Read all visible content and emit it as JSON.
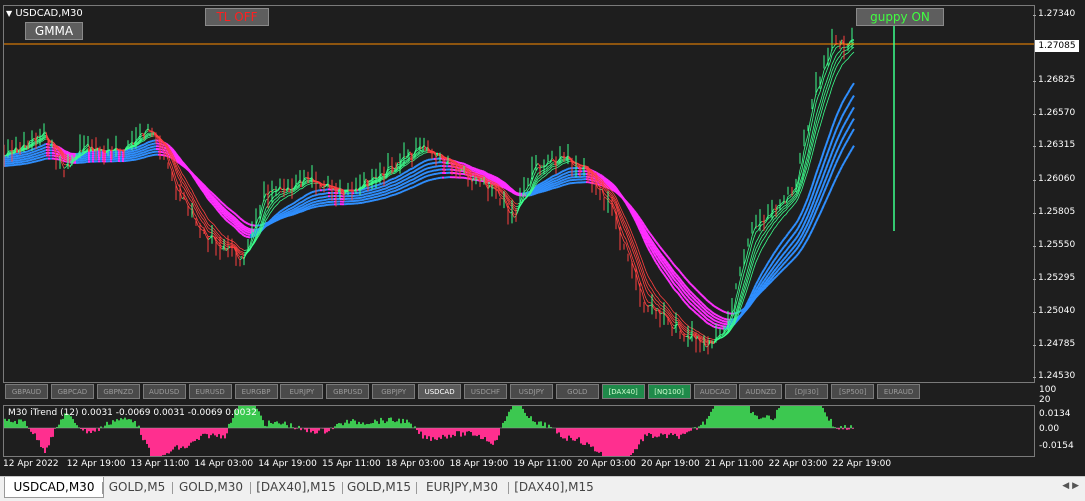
{
  "window_title": "USDCAD,M30",
  "buttons": {
    "gmma": "GMMA",
    "tl": "TL OFF",
    "guppy": "guppy ON"
  },
  "colors": {
    "background": "#1e1e1e",
    "gmma_short_up": "#3cff8c",
    "gmma_short_down": "#ff4040",
    "gmma_long_up": "#2f8fff",
    "gmma_long_down": "#ff2fff",
    "price_line": "#ff8c00",
    "subwindow_positive": "#ff2f8f",
    "subwindow_negative": "#3cc850"
  },
  "price_axis": [
    "1.27340",
    "1.26825",
    "1.26570",
    "1.26315",
    "1.26060",
    "1.25805",
    "1.25550",
    "1.25295",
    "1.25040",
    "1.24785",
    "1.24530"
  ],
  "current_price": "1.27085",
  "symbols": [
    {
      "label": "GBPAUD",
      "state": "normal"
    },
    {
      "label": "GBPCAD",
      "state": "normal"
    },
    {
      "label": "GBPNZD",
      "state": "normal"
    },
    {
      "label": "AUDUSD",
      "state": "normal"
    },
    {
      "label": "EURUSD",
      "state": "normal"
    },
    {
      "label": "EURGBP",
      "state": "normal"
    },
    {
      "label": "EURJPY",
      "state": "normal"
    },
    {
      "label": "GBPUSD",
      "state": "normal"
    },
    {
      "label": "GBPJPY",
      "state": "normal"
    },
    {
      "label": "USDCAD",
      "state": "active"
    },
    {
      "label": "USDCHF",
      "state": "normal"
    },
    {
      "label": "USDJPY",
      "state": "normal"
    },
    {
      "label": "GOLD",
      "state": "normal"
    },
    {
      "label": "[DAX40]",
      "state": "green"
    },
    {
      "label": "[NQ100]",
      "state": "green"
    },
    {
      "label": "AUDCAD",
      "state": "normal"
    },
    {
      "label": "AUDNZD",
      "state": "normal"
    },
    {
      "label": "[DJI30]",
      "state": "normal"
    },
    {
      "label": "[SP500]",
      "state": "normal"
    },
    {
      "label": "EURAUD",
      "state": "normal"
    }
  ],
  "subwindow": {
    "title": "M30  iTrend (12) 0.0031 -0.0069 0.0031 -0.0069 0.0032",
    "axis": [
      "100",
      "20",
      "0.0134",
      "0.00",
      "-0.0154"
    ]
  },
  "time_axis": [
    "12 Apr 2022",
    "12 Apr 19:00",
    "13 Apr 11:00",
    "14 Apr 03:00",
    "14 Apr 19:00",
    "15 Apr 11:00",
    "18 Apr 03:00",
    "18 Apr 19:00",
    "19 Apr 11:00",
    "20 Apr 03:00",
    "20 Apr 19:00",
    "21 Apr 11:00",
    "22 Apr 03:00",
    "22 Apr 19:00"
  ],
  "tabs": [
    {
      "label": "USDCAD,M30",
      "active": true
    },
    {
      "label": "GOLD,M5",
      "active": false
    },
    {
      "label": "GOLD,M30",
      "active": false
    },
    {
      "label": "[DAX40],M15",
      "active": false
    },
    {
      "label": "GOLD,M15",
      "active": false
    },
    {
      "label": "EURJPY,M30",
      "active": false
    },
    {
      "label": "[DAX40],M15",
      "active": false
    }
  ]
}
